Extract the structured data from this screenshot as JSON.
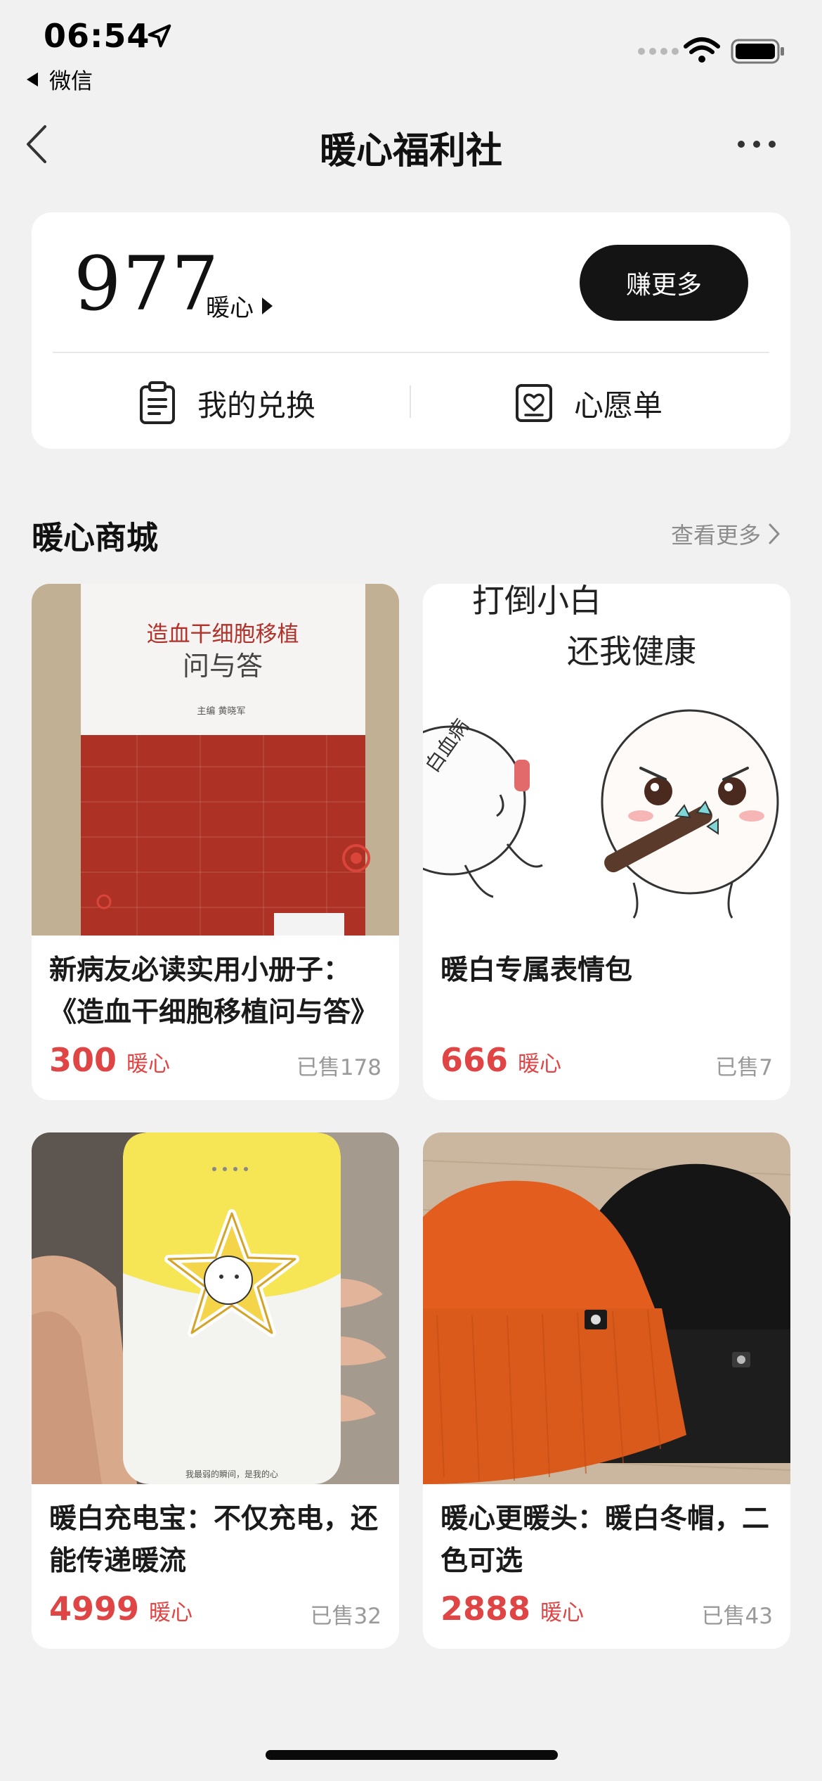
{
  "status_bar": {
    "time": "06:54",
    "back_app": "微信"
  },
  "nav": {
    "title": "暖心福利社"
  },
  "balance": {
    "value": "977",
    "unit": "暖心",
    "earn_button": "赚更多",
    "my_exchange": "我的兑换",
    "wishlist": "心愿单"
  },
  "section": {
    "title": "暖心商城",
    "see_more": "查看更多"
  },
  "products": [
    {
      "title": "新病友必读实用小册子：《造血干细胞移植问与答》",
      "price": "300",
      "unit": "暖心",
      "sold": "已售178",
      "image_text": {
        "book_title_line1": "造血干细胞移植",
        "book_title_line2": "问与答",
        "book_editor": "主编 黄晓军"
      }
    },
    {
      "title": "暖白专属表情包",
      "price": "666",
      "unit": "暖心",
      "sold": "已售7",
      "image_text": {
        "line1": "打倒小白",
        "line2": "还我健康",
        "label": "白血病"
      }
    },
    {
      "title": "暖白充电宝：不仅充电，还能传递暖流",
      "price": "4999",
      "unit": "暖心",
      "sold": "已售32",
      "image_text": {
        "caption": "我最弱的瞬间，是我的心"
      }
    },
    {
      "title": "暖心更暖头：暖白冬帽，二色可选",
      "price": "2888",
      "unit": "暖心",
      "sold": "已售43"
    }
  ],
  "colors": {
    "accent_red": "#e04545",
    "background": "#f1f1f1",
    "card": "#ffffff",
    "dark_button": "#141414"
  }
}
